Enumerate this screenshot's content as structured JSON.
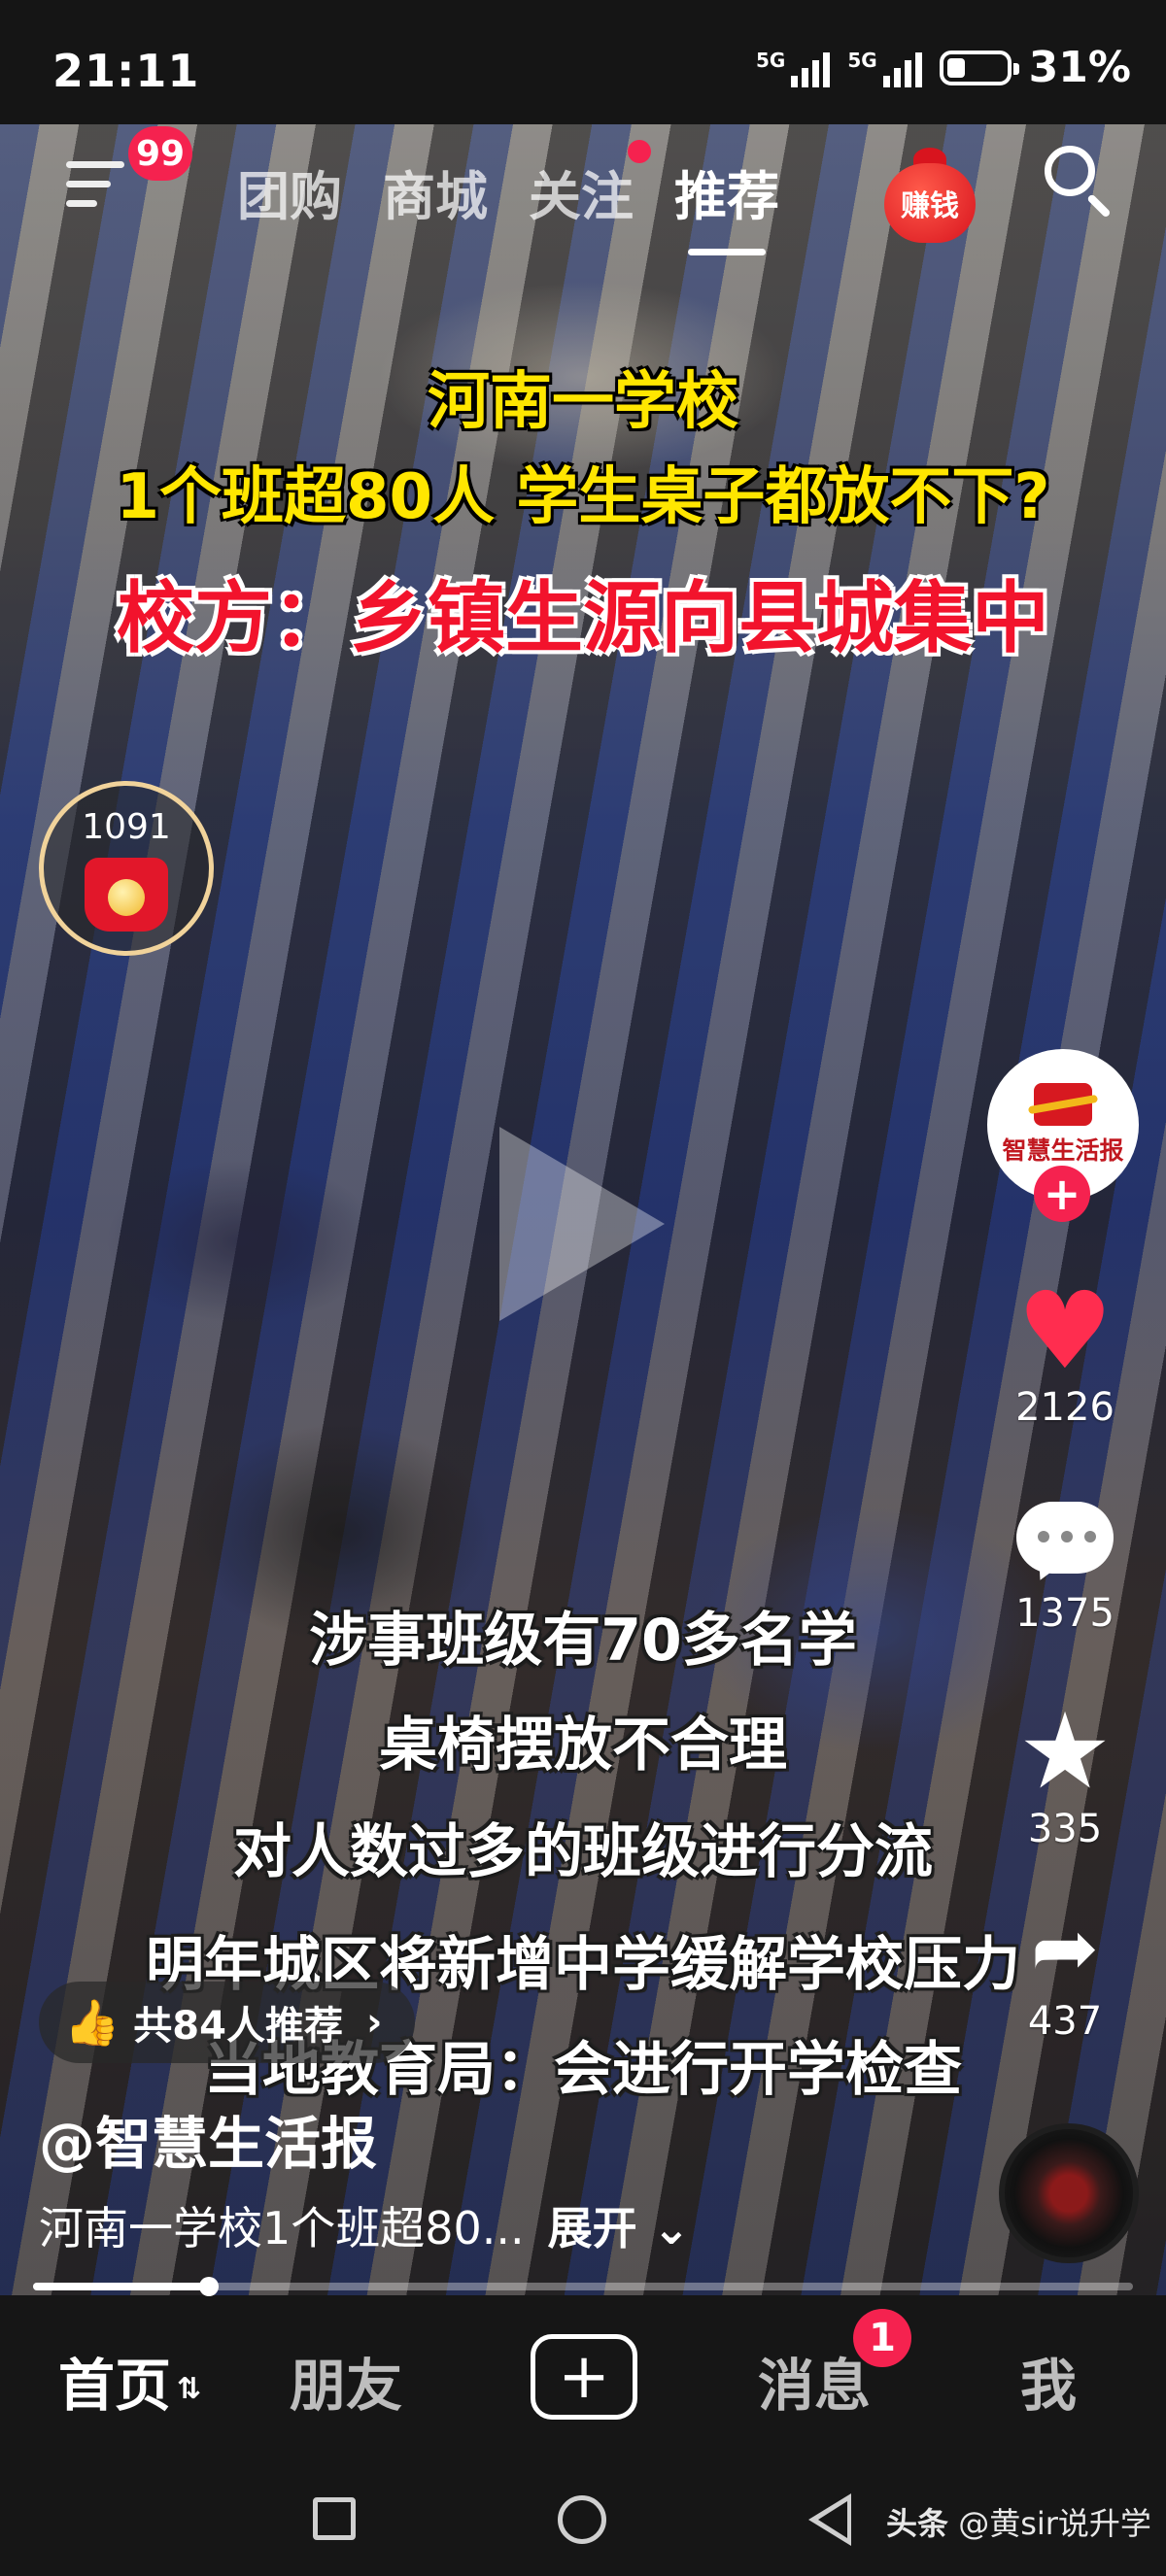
{
  "status_bar": {
    "time": "21:11",
    "signal1_label": "5G",
    "signal2_label": "5G",
    "battery_text": "31%",
    "battery_level_percent": 31
  },
  "top_nav": {
    "menu_badge": "99",
    "tabs": [
      {
        "label": "团购",
        "active": false
      },
      {
        "label": "商城",
        "active": false
      },
      {
        "label": "关注",
        "active": false,
        "has_dot": true
      },
      {
        "label": "推荐",
        "active": true
      }
    ],
    "earn_label": "赚钱",
    "search_icon": "search-icon"
  },
  "video": {
    "headline": {
      "line1": "河南一学校",
      "line2": "1个班超80人 学生桌子都放不下?",
      "line3": "校方：乡镇生源向县城集中"
    },
    "red_packet_count": "1091",
    "subtitles": [
      "涉事班级有70多名学",
      "桌椅摆放不合理",
      "对人数过多的班级进行分流",
      "明年城区将新增中学缓解学校压力",
      "当地教育局：会进行开学检查"
    ],
    "progress_fraction": 0.16
  },
  "right_rail": {
    "author_avatar_text": "智慧生活报",
    "likes": "2126",
    "comments": "1375",
    "favorites": "335",
    "shares": "437"
  },
  "info": {
    "recommend_text": "共84人推荐",
    "author": "@智慧生活报",
    "description": "河南一学校1个班超80...",
    "expand_label": "展开"
  },
  "bottom_tabs": {
    "home": "首页",
    "friends": "朋友",
    "messages": "消息",
    "messages_badge": "1",
    "me": "我"
  },
  "watermark": {
    "source": "头条",
    "account": "@黄sir说升学"
  },
  "colors": {
    "accent_red": "#f5224f",
    "headline_yellow": "#ffe600",
    "headline_red": "#f2132c"
  }
}
